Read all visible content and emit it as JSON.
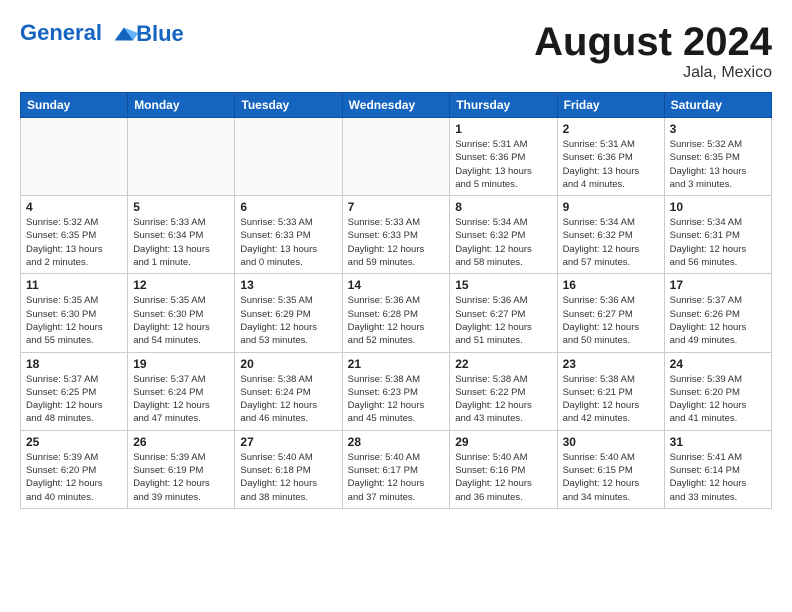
{
  "header": {
    "logo_line1": "General",
    "logo_line2": "Blue",
    "month": "August 2024",
    "location": "Jala, Mexico"
  },
  "weekdays": [
    "Sunday",
    "Monday",
    "Tuesday",
    "Wednesday",
    "Thursday",
    "Friday",
    "Saturday"
  ],
  "weeks": [
    [
      {
        "day": "",
        "info": ""
      },
      {
        "day": "",
        "info": ""
      },
      {
        "day": "",
        "info": ""
      },
      {
        "day": "",
        "info": ""
      },
      {
        "day": "1",
        "info": "Sunrise: 5:31 AM\nSunset: 6:36 PM\nDaylight: 13 hours\nand 5 minutes."
      },
      {
        "day": "2",
        "info": "Sunrise: 5:31 AM\nSunset: 6:36 PM\nDaylight: 13 hours\nand 4 minutes."
      },
      {
        "day": "3",
        "info": "Sunrise: 5:32 AM\nSunset: 6:35 PM\nDaylight: 13 hours\nand 3 minutes."
      }
    ],
    [
      {
        "day": "4",
        "info": "Sunrise: 5:32 AM\nSunset: 6:35 PM\nDaylight: 13 hours\nand 2 minutes."
      },
      {
        "day": "5",
        "info": "Sunrise: 5:33 AM\nSunset: 6:34 PM\nDaylight: 13 hours\nand 1 minute."
      },
      {
        "day": "6",
        "info": "Sunrise: 5:33 AM\nSunset: 6:33 PM\nDaylight: 13 hours\nand 0 minutes."
      },
      {
        "day": "7",
        "info": "Sunrise: 5:33 AM\nSunset: 6:33 PM\nDaylight: 12 hours\nand 59 minutes."
      },
      {
        "day": "8",
        "info": "Sunrise: 5:34 AM\nSunset: 6:32 PM\nDaylight: 12 hours\nand 58 minutes."
      },
      {
        "day": "9",
        "info": "Sunrise: 5:34 AM\nSunset: 6:32 PM\nDaylight: 12 hours\nand 57 minutes."
      },
      {
        "day": "10",
        "info": "Sunrise: 5:34 AM\nSunset: 6:31 PM\nDaylight: 12 hours\nand 56 minutes."
      }
    ],
    [
      {
        "day": "11",
        "info": "Sunrise: 5:35 AM\nSunset: 6:30 PM\nDaylight: 12 hours\nand 55 minutes."
      },
      {
        "day": "12",
        "info": "Sunrise: 5:35 AM\nSunset: 6:30 PM\nDaylight: 12 hours\nand 54 minutes."
      },
      {
        "day": "13",
        "info": "Sunrise: 5:35 AM\nSunset: 6:29 PM\nDaylight: 12 hours\nand 53 minutes."
      },
      {
        "day": "14",
        "info": "Sunrise: 5:36 AM\nSunset: 6:28 PM\nDaylight: 12 hours\nand 52 minutes."
      },
      {
        "day": "15",
        "info": "Sunrise: 5:36 AM\nSunset: 6:27 PM\nDaylight: 12 hours\nand 51 minutes."
      },
      {
        "day": "16",
        "info": "Sunrise: 5:36 AM\nSunset: 6:27 PM\nDaylight: 12 hours\nand 50 minutes."
      },
      {
        "day": "17",
        "info": "Sunrise: 5:37 AM\nSunset: 6:26 PM\nDaylight: 12 hours\nand 49 minutes."
      }
    ],
    [
      {
        "day": "18",
        "info": "Sunrise: 5:37 AM\nSunset: 6:25 PM\nDaylight: 12 hours\nand 48 minutes."
      },
      {
        "day": "19",
        "info": "Sunrise: 5:37 AM\nSunset: 6:24 PM\nDaylight: 12 hours\nand 47 minutes."
      },
      {
        "day": "20",
        "info": "Sunrise: 5:38 AM\nSunset: 6:24 PM\nDaylight: 12 hours\nand 46 minutes."
      },
      {
        "day": "21",
        "info": "Sunrise: 5:38 AM\nSunset: 6:23 PM\nDaylight: 12 hours\nand 45 minutes."
      },
      {
        "day": "22",
        "info": "Sunrise: 5:38 AM\nSunset: 6:22 PM\nDaylight: 12 hours\nand 43 minutes."
      },
      {
        "day": "23",
        "info": "Sunrise: 5:38 AM\nSunset: 6:21 PM\nDaylight: 12 hours\nand 42 minutes."
      },
      {
        "day": "24",
        "info": "Sunrise: 5:39 AM\nSunset: 6:20 PM\nDaylight: 12 hours\nand 41 minutes."
      }
    ],
    [
      {
        "day": "25",
        "info": "Sunrise: 5:39 AM\nSunset: 6:20 PM\nDaylight: 12 hours\nand 40 minutes."
      },
      {
        "day": "26",
        "info": "Sunrise: 5:39 AM\nSunset: 6:19 PM\nDaylight: 12 hours\nand 39 minutes."
      },
      {
        "day": "27",
        "info": "Sunrise: 5:40 AM\nSunset: 6:18 PM\nDaylight: 12 hours\nand 38 minutes."
      },
      {
        "day": "28",
        "info": "Sunrise: 5:40 AM\nSunset: 6:17 PM\nDaylight: 12 hours\nand 37 minutes."
      },
      {
        "day": "29",
        "info": "Sunrise: 5:40 AM\nSunset: 6:16 PM\nDaylight: 12 hours\nand 36 minutes."
      },
      {
        "day": "30",
        "info": "Sunrise: 5:40 AM\nSunset: 6:15 PM\nDaylight: 12 hours\nand 34 minutes."
      },
      {
        "day": "31",
        "info": "Sunrise: 5:41 AM\nSunset: 6:14 PM\nDaylight: 12 hours\nand 33 minutes."
      }
    ]
  ]
}
